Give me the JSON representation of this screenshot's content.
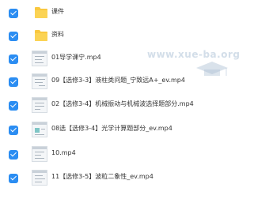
{
  "files": [
    {
      "type": "folder",
      "name": "课件",
      "checked": true
    },
    {
      "type": "folder",
      "name": "资料",
      "checked": true
    },
    {
      "type": "video",
      "name": "01导学课宁.mp4",
      "checked": true
    },
    {
      "type": "video",
      "name": "09【选修3-3】液柱类问题_宁致远A+_ev.mp4",
      "checked": true
    },
    {
      "type": "video",
      "name": "02【选修3-4】机械振动与机械波选择题部分.mp4",
      "checked": true
    },
    {
      "type": "video",
      "name": "08选【选修3-4】光学计算题部分_ev.mp4",
      "checked": true
    },
    {
      "type": "video",
      "name": "10.mp4",
      "checked": true
    },
    {
      "type": "video",
      "name": "11【选修3-5】波粒二象性_ev.mp4",
      "checked": true
    }
  ],
  "watermark": {
    "text": "www.xue-ba.org"
  },
  "colors": {
    "checkbox": "#2b8df2",
    "folder": "#f9c83f",
    "text": "#333333"
  }
}
